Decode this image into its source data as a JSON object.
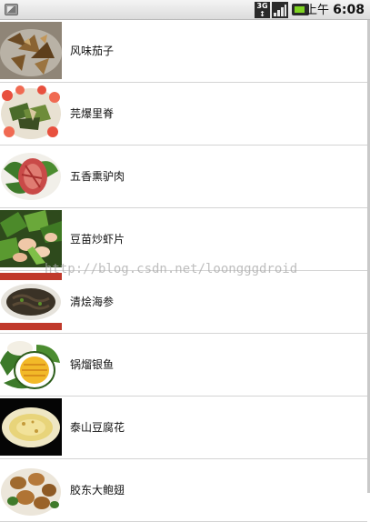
{
  "status_bar": {
    "network_label_top": "3G",
    "network_label_bottom": "↕",
    "time_prefix": "上午",
    "time": "6:08",
    "icons": [
      "notification-icon",
      "3g-icon",
      "signal-icon",
      "battery-icon"
    ],
    "battery_color": "#7ed321"
  },
  "dishes": [
    {
      "name": "风味茄子",
      "image": "eggplant-photo"
    },
    {
      "name": "芫爆里脊",
      "image": "tenderloin-photo"
    },
    {
      "name": "五香熏驴肉",
      "image": "donkey-meat-photo"
    },
    {
      "name": "豆苗炒虾片",
      "image": "shrimp-photo"
    },
    {
      "name": "清烩海参",
      "image": "sea-cucumber-photo"
    },
    {
      "name": "锅熘银鱼",
      "image": "silverfish-photo"
    },
    {
      "name": "泰山豆腐花",
      "image": "tofu-photo"
    },
    {
      "name": "胶东大鲍翅",
      "image": "abalone-photo"
    }
  ],
  "watermark": "http://blog.csdn.net/loongggdroid",
  "colors": {
    "divider": "#d4d4d4",
    "status_bar": "#dcdcdc"
  }
}
